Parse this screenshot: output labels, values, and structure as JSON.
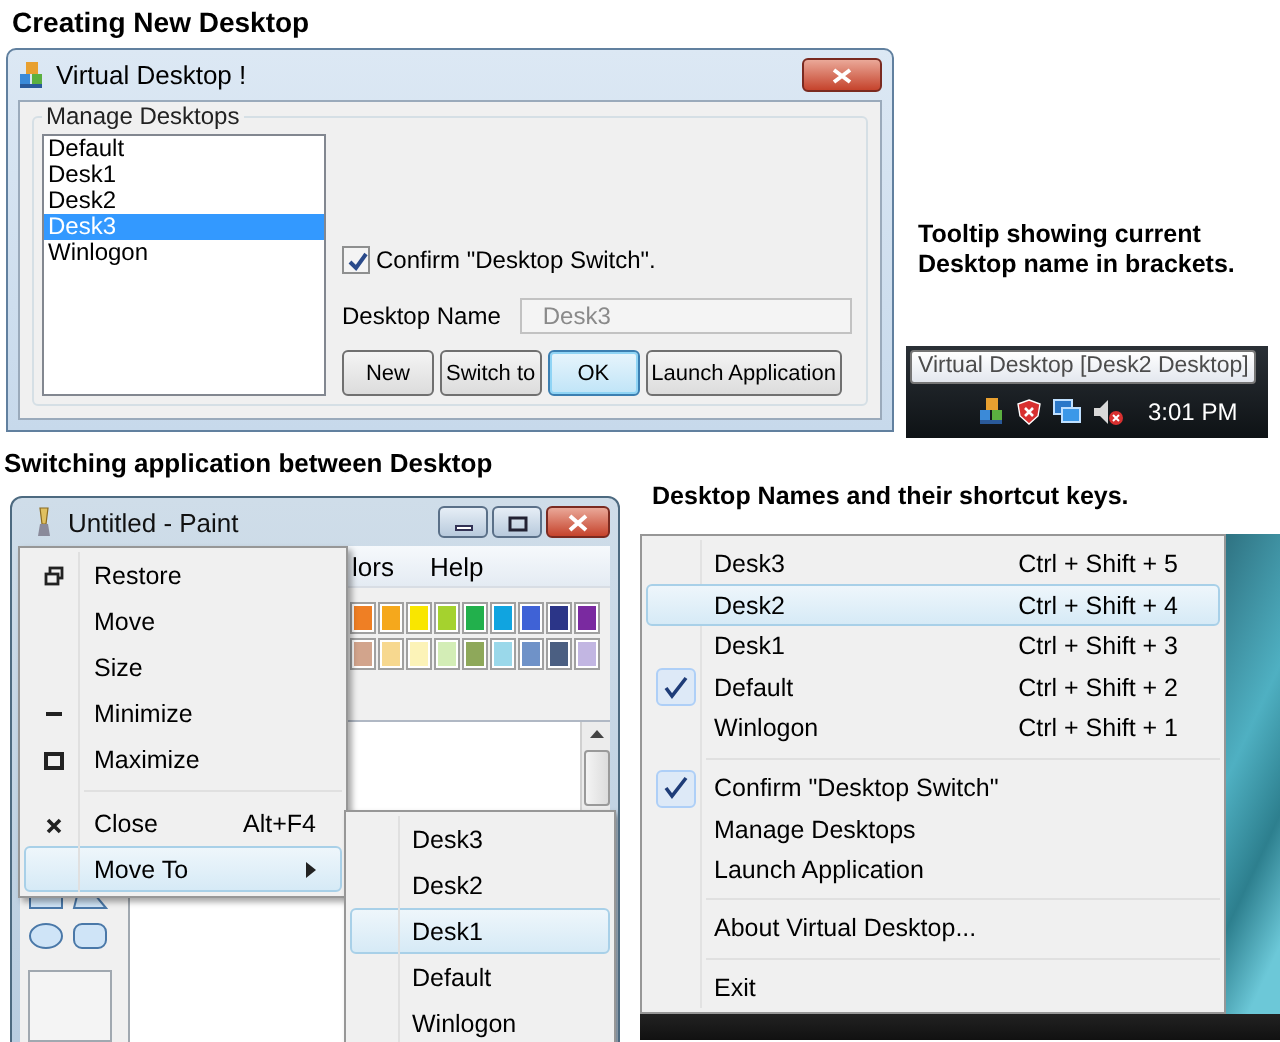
{
  "dialog_section": {
    "heading": "Creating New Desktop",
    "window": {
      "title": "Virtual Desktop !",
      "group_label": "Manage Desktops",
      "desktops": [
        {
          "label": "Default",
          "selected": false
        },
        {
          "label": "Desk1",
          "selected": false
        },
        {
          "label": "Desk2",
          "selected": false
        },
        {
          "label": "Desk3",
          "selected": true
        },
        {
          "label": "Winlogon",
          "selected": false
        }
      ],
      "confirm_switch": {
        "label": "Confirm \"Desktop Switch\".",
        "checked": true
      },
      "desktop_name": {
        "label": "Desktop Name",
        "value": "Desk3",
        "disabled": true
      },
      "buttons": [
        {
          "label": "New",
          "default": false
        },
        {
          "label": "Switch to",
          "default": false
        },
        {
          "label": "OK",
          "default": true
        },
        {
          "label": "Launch Application",
          "default": false
        }
      ]
    }
  },
  "tooltip_section": {
    "caption": "Tooltip showing current Desktop name in brackets.",
    "tooltip": "Virtual Desktop [Desk2 Desktop]",
    "clock": "3:01 PM"
  },
  "paint_section": {
    "heading": "Switching application between Desktop",
    "window_title": "Untitled - Paint",
    "menu_bar": [
      "lors",
      "Help"
    ],
    "palette": [
      {
        "color": "#ef7f24"
      },
      {
        "color": "#f5a81c"
      },
      {
        "color": "#f9e600"
      },
      {
        "color": "#a5d22e"
      },
      {
        "color": "#22b04c"
      },
      {
        "color": "#10a4e0"
      },
      {
        "color": "#3f62d6"
      },
      {
        "color": "#2b3588"
      },
      {
        "color": "#7a2aa0"
      },
      {
        "color": "#d2a48c"
      },
      {
        "color": "#f7d88f"
      },
      {
        "color": "#fcf3b8"
      },
      {
        "color": "#d3edb6"
      },
      {
        "color": "#8ea85a"
      },
      {
        "color": "#9ad8ea"
      },
      {
        "color": "#6f92c8"
      },
      {
        "color": "#4b5f82"
      },
      {
        "color": "#c2b6e2"
      }
    ],
    "system_menu": [
      {
        "kind": "restore",
        "label": "Restore",
        "selected": false
      },
      {
        "kind": "plain",
        "label": "Move",
        "selected": false
      },
      {
        "kind": "plain",
        "label": "Size",
        "selected": false
      },
      {
        "kind": "minimize",
        "label": "Minimize",
        "selected": false
      },
      {
        "kind": "maximize",
        "label": "Maximize",
        "selected": false
      },
      {
        "kind": "separator"
      },
      {
        "kind": "close",
        "label": "Close",
        "shortcut": "Alt+F4",
        "selected": false
      },
      {
        "kind": "submenu",
        "label": "Move To",
        "selected": true
      }
    ],
    "move_to_menu": [
      {
        "label": "Desk3",
        "selected": false
      },
      {
        "label": "Desk2",
        "selected": false
      },
      {
        "label": "Desk1",
        "selected": true
      },
      {
        "label": "Default",
        "selected": false
      },
      {
        "label": "Winlogon",
        "selected": false
      }
    ]
  },
  "tray_menu_section": {
    "heading": "Desktop Names and their shortcut keys.",
    "menu": [
      {
        "kind": "desktop",
        "label": "Desk3",
        "shortcut": "Ctrl + Shift + 5",
        "checked": false,
        "selected": false
      },
      {
        "kind": "desktop",
        "label": "Desk2",
        "shortcut": "Ctrl + Shift + 4",
        "checked": false,
        "selected": true
      },
      {
        "kind": "desktop",
        "label": "Desk1",
        "shortcut": "Ctrl + Shift + 3",
        "checked": false,
        "selected": false
      },
      {
        "kind": "desktop",
        "label": "Default",
        "shortcut": "Ctrl + Shift + 2",
        "checked": true,
        "selected": false
      },
      {
        "kind": "desktop",
        "label": "Winlogon",
        "shortcut": "Ctrl + Shift + 1",
        "checked": false,
        "selected": false
      },
      {
        "kind": "separator"
      },
      {
        "kind": "option",
        "label": "Confirm \"Desktop Switch\"",
        "checked": true,
        "selected": false
      },
      {
        "kind": "option",
        "label": "Manage Desktops",
        "checked": false,
        "selected": false
      },
      {
        "kind": "option",
        "label": "Launch Application",
        "checked": false,
        "selected": false
      },
      {
        "kind": "separator"
      },
      {
        "kind": "option",
        "label": "About Virtual Desktop...",
        "checked": false,
        "selected": false
      },
      {
        "kind": "separator"
      },
      {
        "kind": "option",
        "label": "Exit",
        "checked": false,
        "selected": false
      }
    ]
  }
}
